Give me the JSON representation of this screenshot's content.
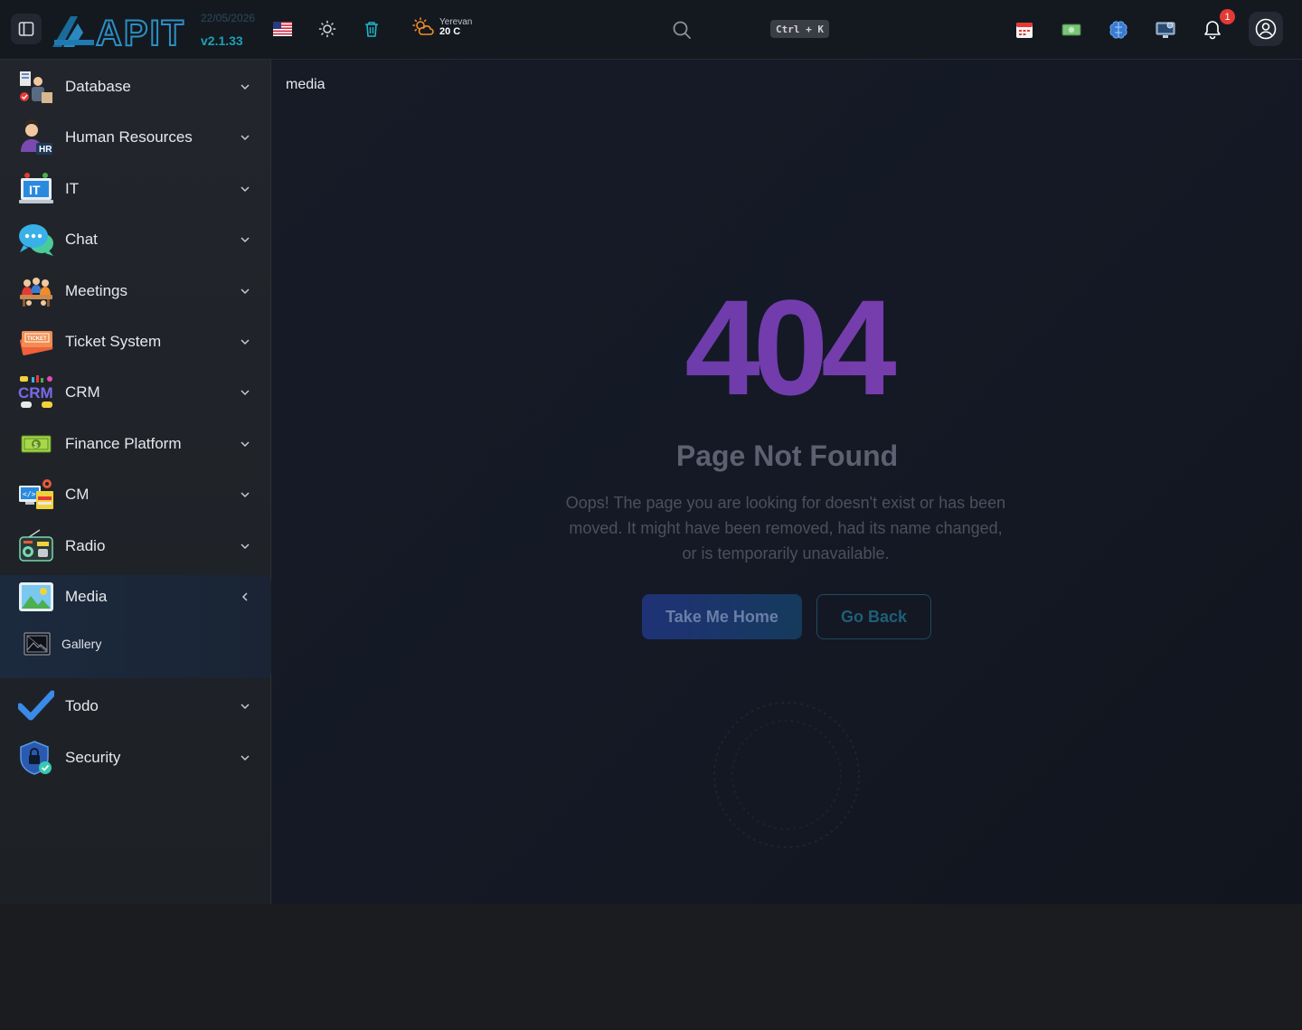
{
  "header": {
    "logo_text": "APIT",
    "date": "22/05/2026",
    "version": "v2.1.33",
    "weather": {
      "city": "Yerevan",
      "temp": "20 C"
    },
    "shortcut": "Ctrl + K",
    "notification_count": "1",
    "icons": [
      "sidebar-toggle-icon",
      "us-flag-icon",
      "sun-icon",
      "trash-icon",
      "weather-icon",
      "search-icon",
      "calendar-icon",
      "money-icon",
      "brain-icon",
      "computer-icon",
      "bell-icon",
      "user-circle-icon"
    ]
  },
  "sidebar": {
    "items": [
      {
        "label": "Database",
        "icon": "database-icon"
      },
      {
        "label": "Human Resources",
        "icon": "human-resources-icon"
      },
      {
        "label": "IT",
        "icon": "it-icon"
      },
      {
        "label": "Chat",
        "icon": "chat-icon"
      },
      {
        "label": "Meetings",
        "icon": "meetings-icon"
      },
      {
        "label": "Ticket System",
        "icon": "ticket-icon"
      },
      {
        "label": "CRM",
        "icon": "crm-icon"
      },
      {
        "label": "Finance Platform",
        "icon": "finance-icon"
      },
      {
        "label": "CM",
        "icon": "cm-icon"
      },
      {
        "label": "Radio",
        "icon": "radio-icon"
      },
      {
        "label": "Media",
        "icon": "media-icon",
        "expanded": true
      },
      {
        "label": "Todo",
        "icon": "todo-icon"
      },
      {
        "label": "Security",
        "icon": "security-icon"
      }
    ],
    "media_sub": {
      "label": "Gallery",
      "icon": "gallery-icon"
    }
  },
  "main": {
    "breadcrumb": "media",
    "code": "404",
    "title": "Page Not Found",
    "message": "Oops! The page you are looking for doesn't exist or has been moved. It might have been removed, had its name changed, or is temporarily unavailable.",
    "home_button": "Take Me Home",
    "back_button": "Go Back"
  },
  "colors": {
    "accent": "#1ea0b4",
    "badge": "#e53935",
    "code_gradient_start": "#5b3aa8",
    "code_gradient_end": "#8a3fb0"
  }
}
